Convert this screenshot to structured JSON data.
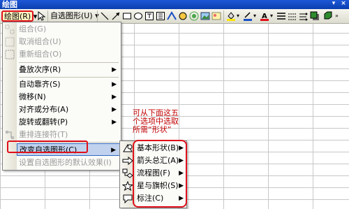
{
  "window": {
    "title": "绘图",
    "buttons": [
      "▾",
      "×"
    ]
  },
  "toolbar": {
    "draw_label": "绘图(R) ▾",
    "autoshapes_label": "自选图形(U) ▾",
    "icons": [
      "pointer-icon",
      "line-icon",
      "arrow-icon",
      "rectangle-icon",
      "oval-icon",
      "textbox-icon",
      "vertical-textbox-icon",
      "wordart-icon",
      "diagram-icon",
      "clipart-icon",
      "picture-icon",
      "fill-color-icon",
      "line-color-icon",
      "font-color-icon",
      "line-style-icon",
      "dash-style-icon",
      "arrow-style-icon",
      "shadow-icon",
      "3d-icon"
    ]
  },
  "menu": {
    "items": [
      {
        "label": "组合(G)",
        "disabled": true
      },
      {
        "label": "取消组合(U)",
        "disabled": true
      },
      {
        "label": "重新组合(O)",
        "disabled": true
      },
      {
        "label": "叠放次序(R)",
        "arrow": "▶"
      },
      {
        "label": "自动靠齐(S)",
        "arrow": "▶"
      },
      {
        "label": "微移(N)",
        "arrow": "▶"
      },
      {
        "label": "对齐或分布(A)",
        "arrow": "▶"
      },
      {
        "label": "旋转或翻转(P)",
        "arrow": "▶"
      },
      {
        "label": "重排连接符(T)",
        "disabled": true
      },
      {
        "label": "改变自选图形(C)",
        "arrow": "▶"
      },
      {
        "label": "设置自选图形的默认效果(I)",
        "disabled": true
      }
    ]
  },
  "submenu": {
    "items": [
      {
        "label": "基本形状(B)",
        "arrow": "▶"
      },
      {
        "label": "箭头总汇(A)",
        "arrow": "▶"
      },
      {
        "label": "流程图(F)",
        "arrow": "▶"
      },
      {
        "label": "星与旗帜(S)",
        "arrow": "▶"
      },
      {
        "label": "标注(C)",
        "arrow": "▶"
      }
    ]
  },
  "annotation": {
    "lines": [
      "可从下面这五",
      "个选项中选取",
      "所需“形状”"
    ],
    "color": "#c00000"
  },
  "colors": {
    "highlight": "#e0101a",
    "title_bar": "#0a3fb0",
    "menu_hover": "#c1d2ee"
  }
}
